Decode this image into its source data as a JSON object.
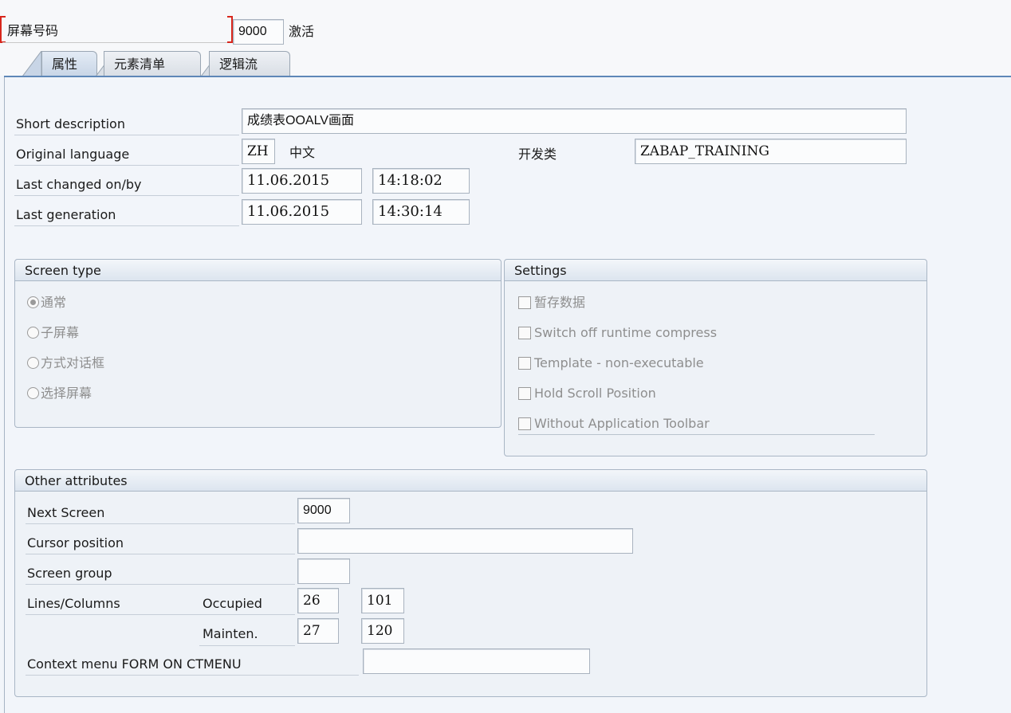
{
  "header": {
    "screen_number_label": "屏幕号码",
    "screen_number": "9000",
    "status": "激活"
  },
  "tabs": [
    {
      "label": "属性"
    },
    {
      "label": "元素清单"
    },
    {
      "label": "逻辑流"
    }
  ],
  "attributes": {
    "short_description_label": "Short description",
    "short_description": "成绩表OOALV画面",
    "original_language_label": "Original language",
    "language_code": "ZH",
    "language_name": "中文",
    "package_label": "开发类",
    "package_value": "ZABAP_TRAINING",
    "last_changed_label": "Last changed on/by",
    "last_changed_date": "11.06.2015",
    "last_changed_time": "14:18:02",
    "last_generation_label": "Last generation",
    "last_generation_date": "11.06.2015",
    "last_generation_time": "14:30:14"
  },
  "screen_type": {
    "title": "Screen type",
    "options": [
      "通常",
      "子屏幕",
      "方式对话框",
      "选择屏幕"
    ],
    "selected": "通常"
  },
  "settings": {
    "title": "Settings",
    "options": [
      "暂存数据",
      "Switch off runtime compress",
      "Template - non-executable",
      "Hold Scroll Position",
      "Without Application Toolbar"
    ]
  },
  "other": {
    "title": "Other attributes",
    "next_screen_label": "Next Screen",
    "next_screen": "9000",
    "cursor_position_label": "Cursor position",
    "cursor_position": "",
    "screen_group_label": "Screen group",
    "screen_group": "",
    "lines_columns_label": "Lines/Columns",
    "occupied_label": "Occupied",
    "occupied_lines": "26",
    "occupied_columns": "101",
    "mainten_label": "Mainten.",
    "mainten_lines": "27",
    "mainten_columns": "120",
    "context_menu_label": "Context menu FORM ON CTMENU",
    "context_menu": ""
  }
}
